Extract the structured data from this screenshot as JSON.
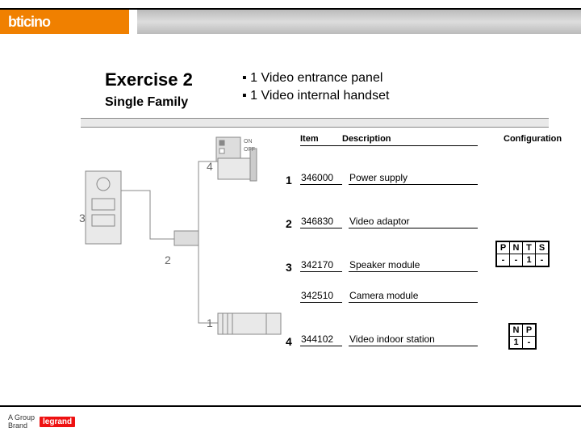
{
  "brand": {
    "logo_text": "bticino"
  },
  "title": {
    "main": "Exercise 2",
    "sub": "Single Family"
  },
  "bullets": [
    "1 Video entrance panel",
    "1 Video internal handset"
  ],
  "table": {
    "headers": {
      "item": "Item",
      "description": "Description",
      "configuration": "Configuration"
    },
    "rows": [
      {
        "num": "1",
        "item": "346000",
        "description": "Power supply"
      },
      {
        "num": "2",
        "item": "346830",
        "description": "Video adaptor"
      },
      {
        "num": "3",
        "item": "342170",
        "description": "Speaker module"
      },
      {
        "num": "",
        "item": "342510",
        "description": "Camera module"
      },
      {
        "num": "4",
        "item": "344102",
        "description": "Video indoor station"
      }
    ]
  },
  "diagram_labels": {
    "n1": "1",
    "n2": "2",
    "n3": "3",
    "n4": "4",
    "on": "ON",
    "off": "OFF"
  },
  "config_boxes": {
    "box1": {
      "headers": [
        "P",
        "N",
        "T",
        "S"
      ],
      "values": [
        "-",
        "-",
        "1",
        "-"
      ]
    },
    "box2": {
      "headers": [
        "N",
        "P"
      ],
      "values": [
        "1",
        "-"
      ]
    }
  },
  "footer": {
    "group": "A Group",
    "brand": "Brand",
    "legrand": "legrand"
  }
}
